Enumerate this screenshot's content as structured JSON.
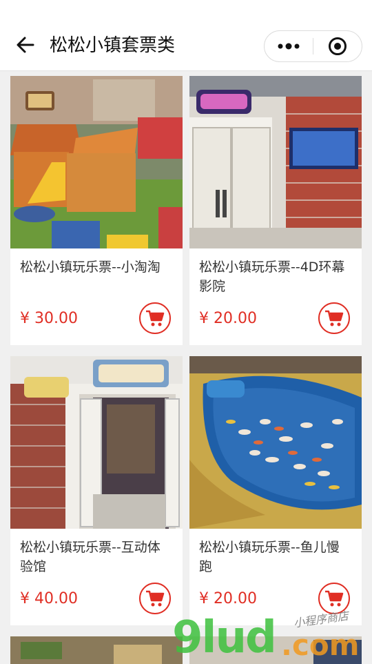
{
  "nav": {
    "title": "松松小镇套票类",
    "back_icon": "back-arrow-icon",
    "more_icon": "more-dots-icon",
    "close_icon": "target-circle-icon"
  },
  "colors": {
    "price": "#e02e24",
    "background": "#f0f0f0",
    "card": "#ffffff"
  },
  "products": [
    {
      "name": "松松小镇玩乐票--小淘淘",
      "price": "¥ 30.00",
      "cart_icon": "cart-icon"
    },
    {
      "name": "松松小镇玩乐票--4D环幕影院",
      "price": "¥ 20.00",
      "cart_icon": "cart-icon"
    },
    {
      "name": "松松小镇玩乐票--互动体验馆",
      "price": "¥ 40.00",
      "cart_icon": "cart-icon"
    },
    {
      "name": "松松小镇玩乐票--鱼儿慢跑",
      "price": "¥ 20.00",
      "cart_icon": "cart-icon"
    }
  ],
  "watermark": {
    "brand": "9lud",
    "suffix": ".com",
    "tagline": "小程序商店"
  }
}
